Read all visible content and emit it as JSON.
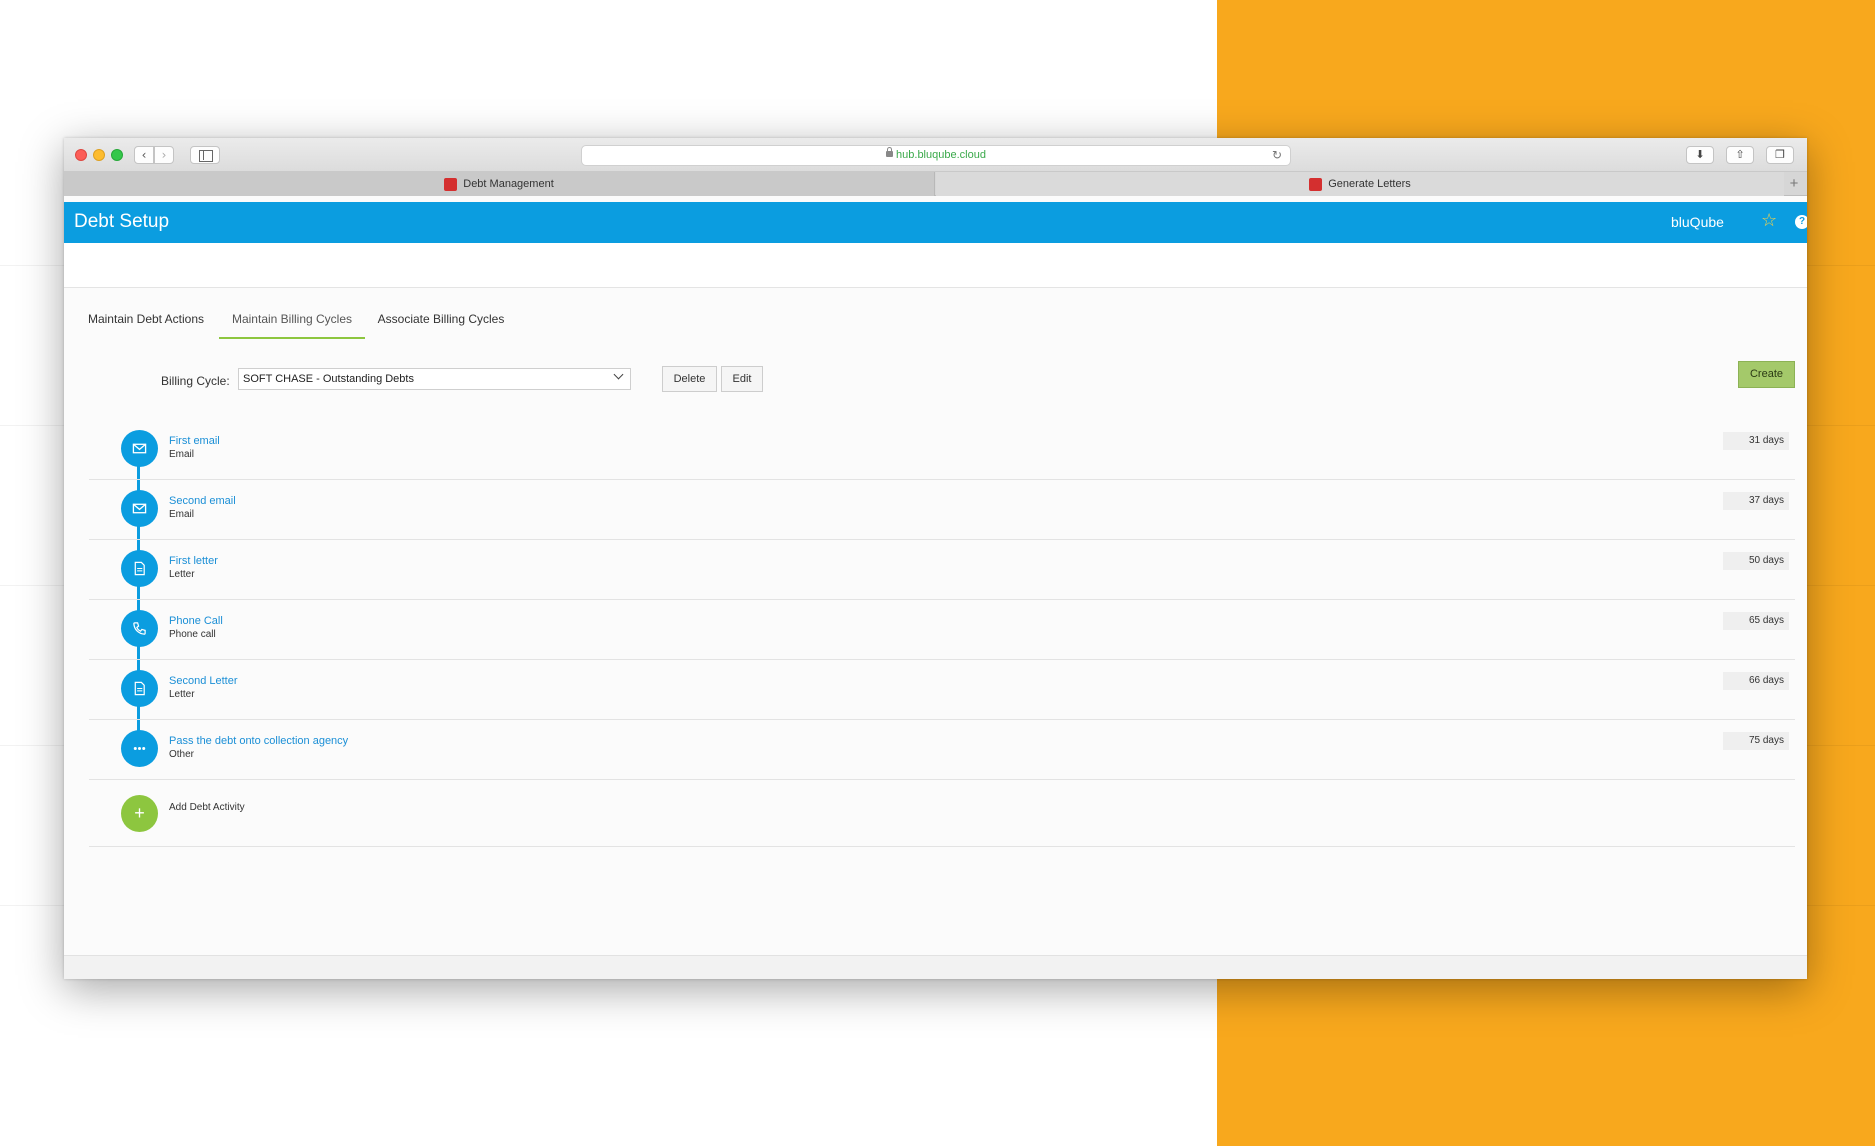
{
  "browser": {
    "url": "hub.bluqube.cloud",
    "tabs": [
      {
        "label": "Debt Management"
      },
      {
        "label": "Generate Letters"
      }
    ]
  },
  "header": {
    "title": "Debt Setup",
    "brand": "bluQube"
  },
  "tabs": [
    {
      "label": "Maintain Debt Actions"
    },
    {
      "label": "Maintain Billing Cycles"
    },
    {
      "label": "Associate Billing Cycles"
    }
  ],
  "form": {
    "billing_cycle_label": "Billing Cycle:",
    "billing_cycle_value": "SOFT CHASE - Outstanding Debts",
    "delete_label": "Delete",
    "edit_label": "Edit",
    "create_label": "Create"
  },
  "activities": [
    {
      "name": "First email",
      "type": "Email",
      "days": "31 days",
      "icon": "mail-icon"
    },
    {
      "name": "Second email",
      "type": "Email",
      "days": "37 days",
      "icon": "mail-icon"
    },
    {
      "name": "First letter",
      "type": "Letter",
      "days": "50 days",
      "icon": "document-icon"
    },
    {
      "name": "Phone Call",
      "type": "Phone call",
      "days": "65 days",
      "icon": "phone-icon"
    },
    {
      "name": "Second Letter",
      "type": "Letter",
      "days": "66 days",
      "icon": "document-icon"
    },
    {
      "name": "Pass the debt onto collection agency",
      "type": "Other",
      "days": "75 days",
      "icon": "more-icon"
    }
  ],
  "add_activity_label": "Add Debt Activity",
  "colors": {
    "accent_blue": "#0b9de0",
    "accent_green": "#8dc63f",
    "background_orange": "#f8a81d"
  }
}
